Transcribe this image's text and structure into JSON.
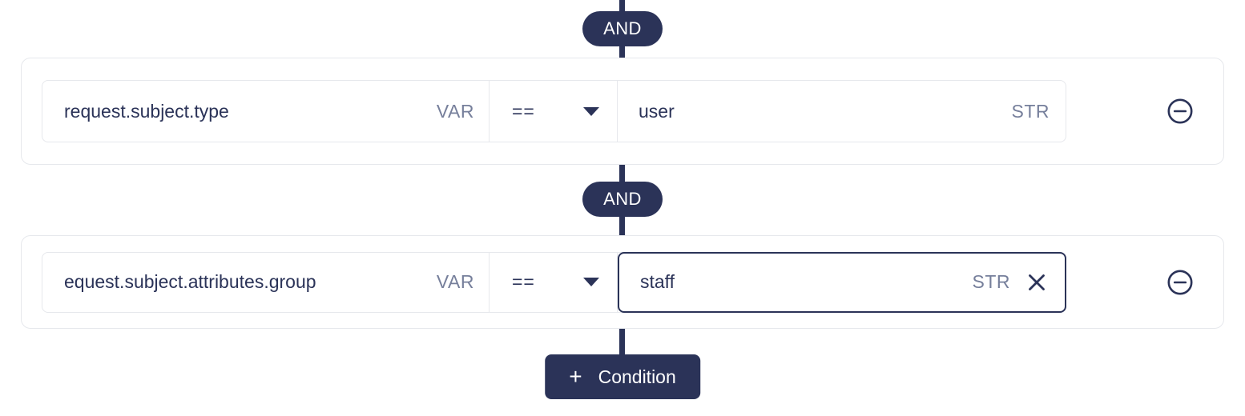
{
  "logic": {
    "operator_label": "AND",
    "accent_color": "#2b3358",
    "border_color": "#e6e8ec",
    "muted_text_color": "#767f9b"
  },
  "conditions": [
    {
      "variable": "request.subject.type",
      "variable_type_badge": "VAR",
      "operator": "==",
      "value": "user",
      "value_type_badge": "STR",
      "focused": false,
      "remove_icon": "circle-minus-icon"
    },
    {
      "variable": "equest.subject.attributes.group",
      "variable_type_badge": "VAR",
      "operator": "==",
      "value": "staff",
      "value_type_badge": "STR",
      "focused": true,
      "clear_icon": "close-icon",
      "remove_icon": "circle-minus-icon"
    }
  ],
  "add_condition": {
    "label": "Condition",
    "plus_icon": "plus-icon",
    "plus_glyph": "+"
  }
}
